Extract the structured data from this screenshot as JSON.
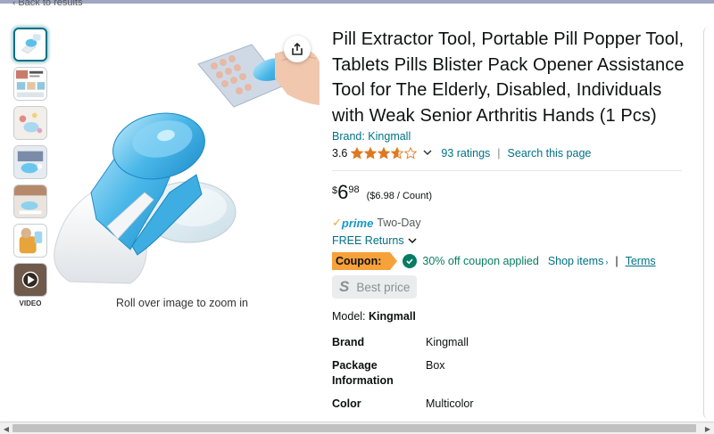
{
  "nav": {
    "back_label": "Back to results"
  },
  "gallery": {
    "video_label": "VIDEO",
    "zoom_hint": "Roll over image to zoom in"
  },
  "product": {
    "title": "Pill Extractor Tool, Portable Pill Popper Tool, Tablets Pills Blister Pack Opener Assistance Tool for The Elderly, Disabled, Individuals with Weak Senior Arthritis Hands (1 Pcs)",
    "brand_link": "Brand: Kingmall",
    "rating": "3.6",
    "rating_value": 3.6,
    "ratings_count": "93 ratings",
    "search_page": "Search this page"
  },
  "price": {
    "symbol": "$",
    "whole": "6",
    "fraction": "98",
    "unit": "($6.98 / Count)"
  },
  "prime": {
    "check": "✓",
    "word": "prime",
    "delivery": "Two-Day",
    "returns": "FREE Returns"
  },
  "coupon": {
    "badge": "Coupon:",
    "applied": "30% off coupon applied",
    "shop_items": "Shop items",
    "sep": "|",
    "terms": "Terms"
  },
  "best_price": {
    "icon": "S",
    "label": "Best price"
  },
  "model": {
    "label": "Model:",
    "value": "Kingmall"
  },
  "specs": [
    {
      "key": "Brand",
      "value": "Kingmall"
    },
    {
      "key": "Package Information",
      "value": "Box"
    },
    {
      "key": "Color",
      "value": "Multicolor"
    }
  ],
  "colors": {
    "link": "#007185",
    "coupon_badge": "#f7a13b",
    "coupon_green": "#067d62",
    "prime_blue": "#1799c6",
    "star": "#de7921"
  },
  "icons": [
    "chevron-left-icon",
    "share-icon",
    "star-icon",
    "chevron-down-icon",
    "check-circle-icon",
    "play-icon"
  ]
}
